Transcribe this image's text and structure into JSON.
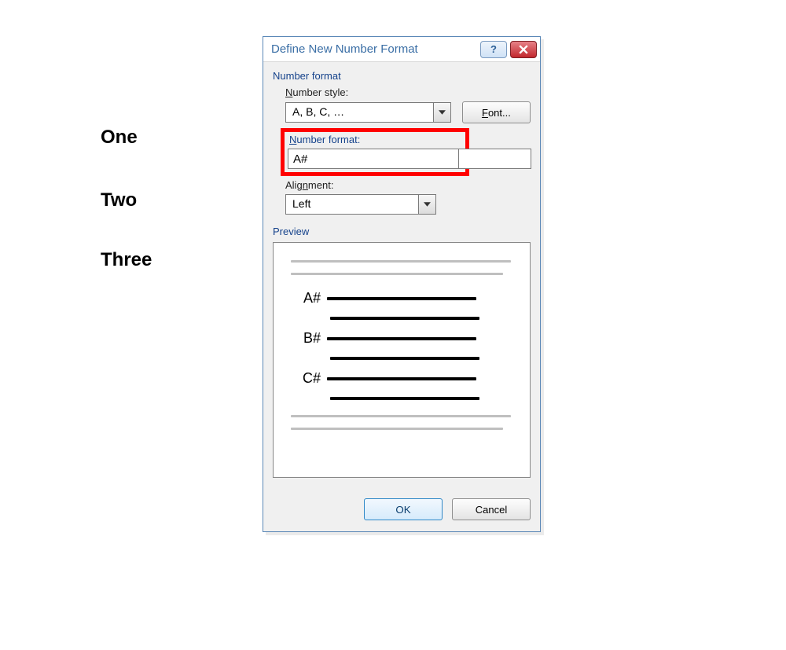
{
  "sideLabels": {
    "one": "One",
    "two": "Two",
    "three": "Three"
  },
  "dialog": {
    "title": "Define New Number Format",
    "help": "?",
    "sections": {
      "numberFormatGroup": "Number format",
      "previewGroup": "Preview"
    },
    "numberStyle": {
      "label": "Number style:",
      "value": "A, B, C, …"
    },
    "fontButton": "Font...",
    "numberFormatField": {
      "label": "Number format:",
      "value": "A#"
    },
    "alignment": {
      "label": "Alignment:",
      "value": "Left"
    },
    "preview": {
      "item1": "A#",
      "item2": "B#",
      "item3": "C#"
    },
    "buttons": {
      "ok": "OK",
      "cancel": "Cancel"
    }
  }
}
